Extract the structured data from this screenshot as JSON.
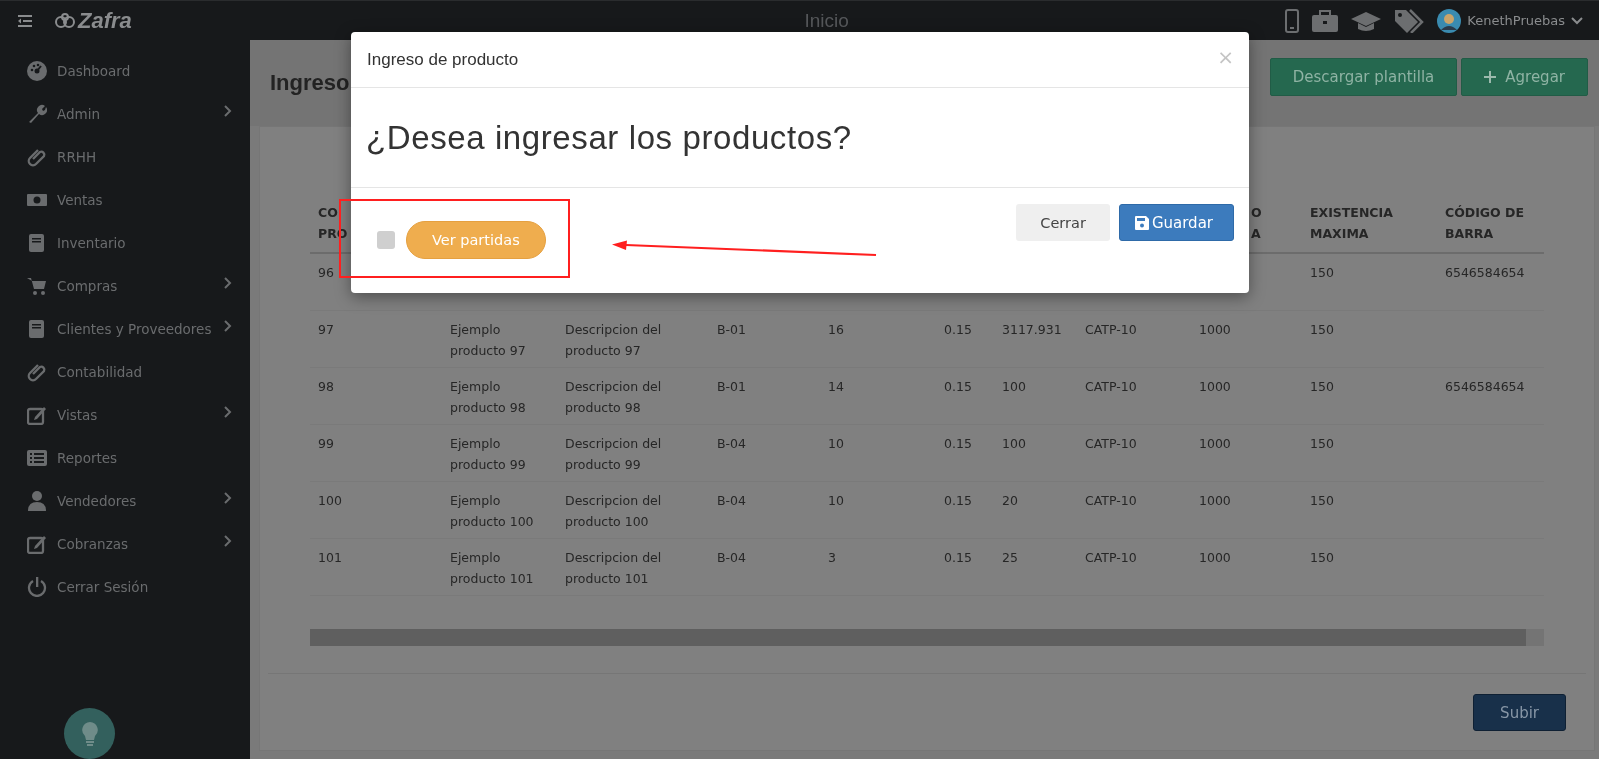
{
  "topbar": {
    "logo": "Zafra",
    "title": "Inicio",
    "user": "KenethPruebas"
  },
  "sidebar": {
    "items": [
      {
        "label": "Dashboard",
        "has_submenu": false
      },
      {
        "label": "Admin",
        "has_submenu": true
      },
      {
        "label": "RRHH",
        "has_submenu": false
      },
      {
        "label": "Ventas",
        "has_submenu": false
      },
      {
        "label": "Inventario",
        "has_submenu": false
      },
      {
        "label": "Compras",
        "has_submenu": true
      },
      {
        "label": "Clientes y Proveedores",
        "has_submenu": true
      },
      {
        "label": "Contabilidad",
        "has_submenu": false
      },
      {
        "label": "Vistas",
        "has_submenu": true
      },
      {
        "label": "Reportes",
        "has_submenu": false
      },
      {
        "label": "Vendedores",
        "has_submenu": true
      },
      {
        "label": "Cobranzas",
        "has_submenu": true
      },
      {
        "label": "Cerrar Sesión",
        "has_submenu": false
      }
    ]
  },
  "page": {
    "title": "Ingreso",
    "buttons": [
      {
        "label": "Descargar plantilla",
        "kind": "plain"
      },
      {
        "label": "Agregar",
        "kind": "add"
      }
    ]
  },
  "table": {
    "columns": [
      {
        "text": "CO\nPRO",
        "kind": "head"
      },
      null,
      null,
      null,
      null,
      null,
      null,
      null,
      {
        "text": "O\nA",
        "kind": "tail"
      },
      {
        "text": "EXISTENCIA MAXIMA",
        "kind": "head"
      },
      {
        "text": "CÓDIGO DE BARRA",
        "kind": "head"
      }
    ],
    "rows": [
      {
        "cells": [
          "96",
          null,
          null,
          null,
          null,
          null,
          null,
          null,
          null,
          "150",
          "6546584654"
        ]
      },
      {
        "cells": [
          "97",
          "Ejemplo producto 97",
          "Descripcion del producto 97",
          "B-01",
          "16",
          "0.15",
          "3117.931",
          "CATP-10",
          "1000",
          "150",
          null
        ]
      },
      {
        "cells": [
          "98",
          "Ejemplo producto 98",
          "Descripcion del producto 98",
          "B-01",
          "14",
          "0.15",
          "100",
          "CATP-10",
          "1000",
          "150",
          "6546584654"
        ]
      },
      {
        "cells": [
          "99",
          "Ejemplo producto 99",
          "Descripcion del producto 99",
          "B-04",
          "10",
          "0.15",
          "100",
          "CATP-10",
          "1000",
          "150",
          null
        ]
      },
      {
        "cells": [
          "100",
          "Ejemplo producto 100",
          "Descripcion del producto 100",
          "B-04",
          "10",
          "0.15",
          "20",
          "CATP-10",
          "1000",
          "150",
          null
        ]
      },
      {
        "cells": [
          "101",
          "Ejemplo producto 101",
          "Descripcion del producto 101",
          "B-04",
          "3",
          "0.15",
          "25",
          "CATP-10",
          "1000",
          "150",
          null
        ]
      }
    ]
  },
  "submit_button": "Subir",
  "modal": {
    "title": "Ingreso de producto",
    "close": "×",
    "question": "¿Desea ingresar los productos?",
    "checkbox": {
      "checked": false
    },
    "partidas_button": "Ver partidas",
    "buttons": [
      {
        "label": "Cerrar",
        "kind": "default"
      },
      {
        "label": "Guardar",
        "kind": "primary"
      }
    ]
  }
}
